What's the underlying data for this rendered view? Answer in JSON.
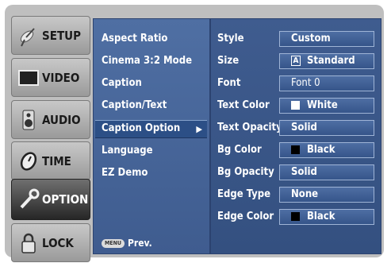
{
  "side_menu": [
    {
      "label": "SETUP",
      "icon": "satellite-dish-icon",
      "active": false
    },
    {
      "label": "VIDEO",
      "icon": "monitor-icon",
      "active": false
    },
    {
      "label": "AUDIO",
      "icon": "speaker-icon",
      "active": false
    },
    {
      "label": "TIME",
      "icon": "clock-icon",
      "active": false
    },
    {
      "label": "OPTION",
      "icon": "wrench-icon",
      "active": true
    },
    {
      "label": "LOCK",
      "icon": "padlock-icon",
      "active": false
    }
  ],
  "option_menu": {
    "items": [
      "Aspect Ratio",
      "Cinema 3:2 Mode",
      "Caption",
      "Caption/Text",
      "Caption Option",
      "Language",
      "EZ Demo"
    ],
    "selected_index": 4,
    "prev_key": "MENU",
    "prev_label": "Prev."
  },
  "caption_options": [
    {
      "label": "Style",
      "value": "Custom"
    },
    {
      "label": "Size",
      "value": "Standard",
      "key": "A"
    },
    {
      "label": "Font",
      "value": "Font 0"
    },
    {
      "label": "Text Color",
      "value": "White",
      "swatch": "#ffffff"
    },
    {
      "label": "Text Opacity",
      "value": "Solid"
    },
    {
      "label": "Bg Color",
      "value": "Black",
      "swatch": "#000000"
    },
    {
      "label": "Bg Opacity",
      "value": "Solid"
    },
    {
      "label": "Edge Type",
      "value": "None"
    },
    {
      "label": "Edge Color",
      "value": "Black",
      "swatch": "#000000"
    }
  ],
  "colors": {
    "panel_blue": "#3f5c8f",
    "selection_blue": "#2c4f86",
    "frame_gray": "#bfbfbf"
  }
}
